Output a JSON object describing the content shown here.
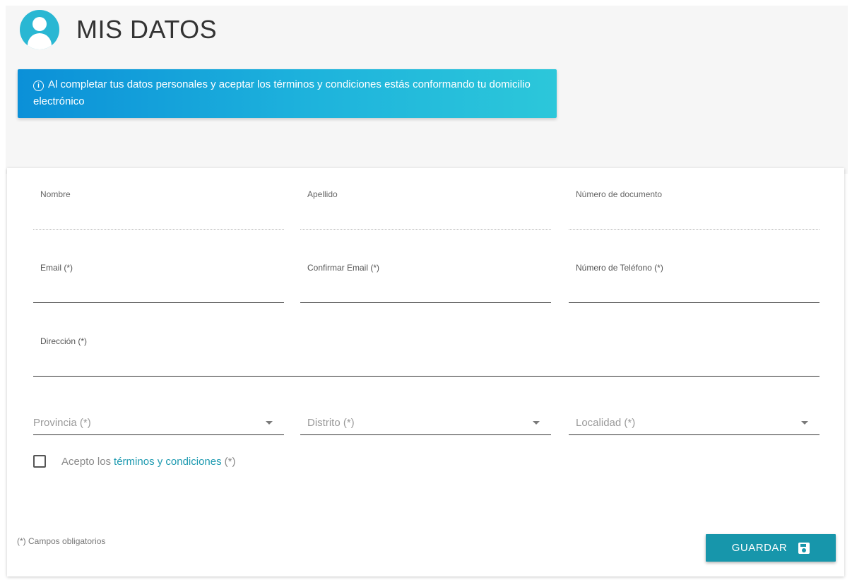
{
  "header": {
    "title": "MIS DATOS",
    "icon": "user-circle-icon"
  },
  "banner": {
    "icon": "info-icon",
    "text": "Al completar tus datos personales y aceptar los términos y condiciones estás conformando tu domicilio electrónico"
  },
  "form": {
    "fields": {
      "nombre": {
        "label": "Nombre",
        "value": ""
      },
      "apellido": {
        "label": "Apellido",
        "value": ""
      },
      "documento": {
        "label": "Número de documento",
        "value": ""
      },
      "email": {
        "label": "Email (*)",
        "value": ""
      },
      "confirmar_email": {
        "label": "Confirmar Email (*)",
        "value": ""
      },
      "telefono": {
        "label": "Número de Teléfono (*)",
        "value": ""
      },
      "direccion": {
        "label": "Dirección (*)",
        "value": ""
      }
    },
    "selects": {
      "provincia": {
        "placeholder": "Provincia (*)"
      },
      "distrito": {
        "placeholder": "Distrito (*)"
      },
      "localidad": {
        "placeholder": "Localidad (*)"
      }
    },
    "terms": {
      "prefix": "Acepto los",
      "link": "términos y condiciones",
      "suffix": "(*)",
      "checked": false
    },
    "footnote": "(*) Campos obligatorios",
    "save_label": "GUARDAR",
    "save_icon": "floppy-disk-icon"
  },
  "colors": {
    "accent": "#29b7d3",
    "banner_start": "#0b90d8",
    "banner_end": "#2cc7da",
    "button": "#1796ab",
    "link": "#1e9ab0"
  }
}
